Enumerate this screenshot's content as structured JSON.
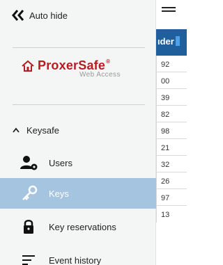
{
  "sidebar": {
    "autohide_label": "Auto hide",
    "logo": {
      "name": "ProxerSafe",
      "registered": "®",
      "subtitle": "Web Access",
      "color": "#b31e22"
    },
    "section": {
      "label": "Keysafe",
      "expanded": true
    },
    "items": [
      {
        "label": "Users",
        "icon": "user-gear-icon",
        "active": false
      },
      {
        "label": "Keys",
        "icon": "key-icon",
        "active": true
      },
      {
        "label": "Key reservations",
        "icon": "lock-icon",
        "active": false
      },
      {
        "label": "Event history",
        "icon": "history-list-icon",
        "active": false
      }
    ],
    "active_color": "#a5c4e0"
  },
  "table": {
    "header_label": "ıder",
    "header_color": "#1f5f9c",
    "rows": [
      "92",
      "00",
      "39",
      "82",
      "98",
      "21",
      "32",
      "26",
      "97",
      "13"
    ]
  }
}
